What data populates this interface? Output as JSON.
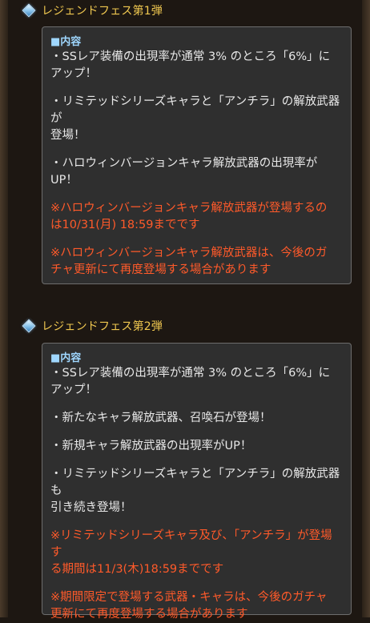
{
  "section1": {
    "title": "レジェンドフェス第1弾",
    "box_heading": "■内容",
    "lines": [
      "・SSレア装備の出現率が通常 3% のところ「6%」に",
      "アップ！",
      "・リミテッドシリーズキャラと「アンチラ」の解放武器が",
      "登場！",
      "・ハロウィンバージョンキャラ解放武器の出現率が",
      "UP！",
      "※ハロウィンバージョンキャラ解放武器が登場するの",
      "は10/31(月) 18:59までです",
      "※ハロウィンバージョンキャラ解放武器は、今後のガ",
      "チャ更新にて再度登場する場合があります"
    ]
  },
  "section2": {
    "title": "レジェンドフェス第2弾",
    "box_heading": "■内容",
    "lines": [
      "・SSレア装備の出現率が通常 3% のところ「6%」に",
      "アップ！",
      "・新たなキャラ解放武器、召喚石が登場！",
      "・新規キャラ解放武器の出現率がUP！",
      "・リミテッドシリーズキャラと「アンチラ」の解放武器も",
      "引き続き登場！",
      "※リミテッドシリーズキャラ及び、「アンチラ」が登場す",
      "る期間は11/3(木)18:59までです",
      "※期間限定で登場する武器・キャラは、今後のガチャ",
      "更新にて再度登場する場合があります"
    ]
  },
  "colors": {
    "title": "#f0c850",
    "heading": "#9fd7ff",
    "text": "#e8e8e8",
    "notice": "#ff5a2a",
    "box_bg": "#2f2f2f",
    "page_bg": "#1d1712"
  },
  "icons": {
    "section_marker": "diamond-icon"
  }
}
